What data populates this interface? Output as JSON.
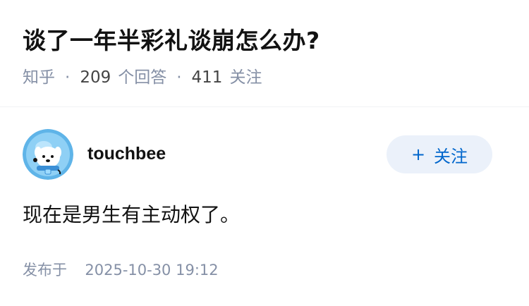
{
  "question": {
    "title": "谈了一年半彩礼谈崩怎么办?",
    "site": "知乎",
    "answers_count": "209",
    "answers_label": "个回答",
    "followers_count": "411",
    "followers_label": "关注"
  },
  "author": {
    "name": "touchbee",
    "avatar_icon": "dog-astronaut-avatar-icon"
  },
  "follow_button": {
    "icon": "+",
    "label": "关注"
  },
  "answer": {
    "content": "现在是男生有主动权了。",
    "published_label": "发布于",
    "published_time": "2025-10-30 19:12"
  },
  "colors": {
    "accent": "#0066cc",
    "button_bg": "#ebf1fa",
    "muted": "#8590a6",
    "text": "#121212"
  }
}
